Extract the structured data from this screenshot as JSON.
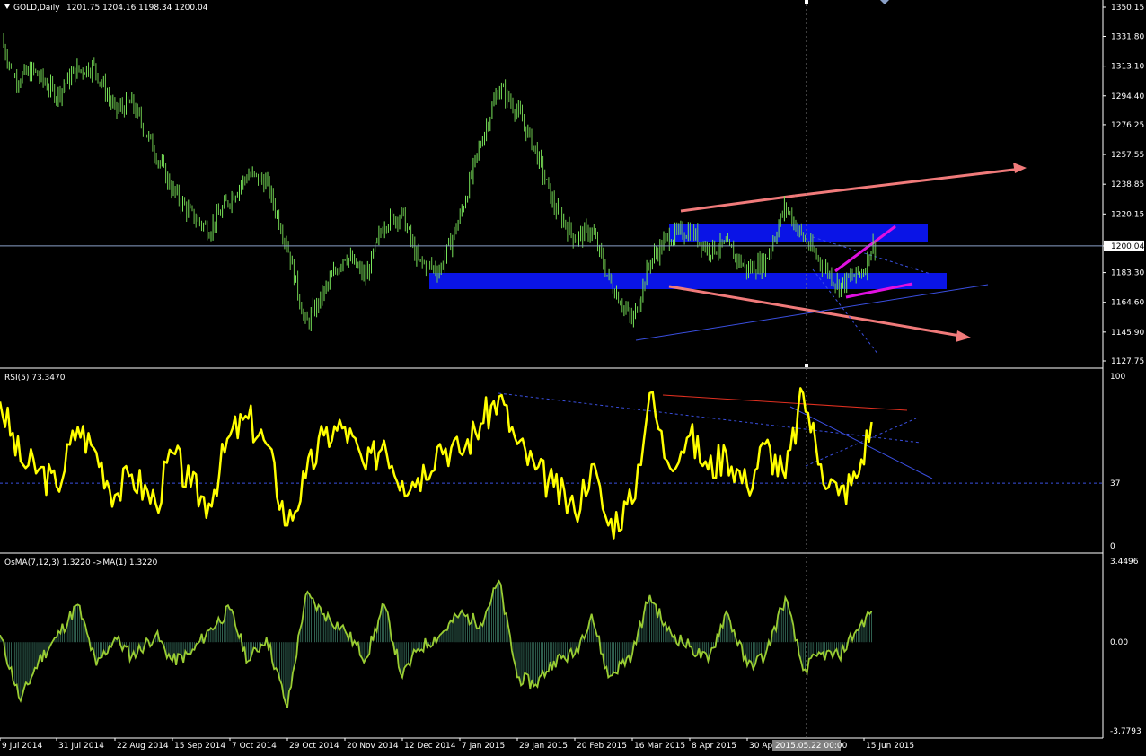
{
  "header": {
    "symbol": "GOLD,Daily",
    "ohlc": "1201.75 1204.16 1198.34 1200.04"
  },
  "colors": {
    "background": "#000000",
    "bull_candle": "#78e65a",
    "bear_candle": "#6ec84e",
    "rsi_line": "#ffff00",
    "osma_line": "#9acd32",
    "osma_hist": "#2f5f4f",
    "zone_fill": "#0a14e6",
    "trend_arrow": "#f07a7a",
    "magenta_line": "#e010e0",
    "trend_blue": "#3a4fe0",
    "grid_text": "#ffffff",
    "current_price_line": "#8aa0c8"
  },
  "chart_data": [
    {
      "type": "candlestick",
      "title": "GOLD,Daily",
      "ylim": [
        1127.75,
        1350.15
      ],
      "current_price": "1200.04",
      "y_tick_labels": [
        "1350.15",
        "1331.80",
        "1313.10",
        "1294.40",
        "1276.25",
        "1257.55",
        "1238.85",
        "1220.15",
        "1200.04",
        "1183.30",
        "1164.60",
        "1145.90",
        "1127.75"
      ],
      "x_tick_labels": [
        "9 Jul 2014",
        "31 Jul 2014",
        "22 Aug 2014",
        "15 Sep 2014",
        "7 Oct 2014",
        "29 Oct 2014",
        "20 Nov 2014",
        "12 Dec 2014",
        "7 Jan 2015",
        "29 Jan 2015",
        "20 Feb 2015",
        "16 Mar 2015",
        "8 Apr 2015",
        "30 Apr 2015",
        "15 Jun 2015"
      ],
      "crosshair_date_label": "2015.05.22 00:00",
      "close_path": [
        [
          "9 Jul 2014",
          1331
        ],
        [
          "15 Jul 2014",
          1305
        ],
        [
          "22 Jul 2014",
          1310
        ],
        [
          "31 Jul 2014",
          1295
        ],
        [
          "7 Aug 2014",
          1310
        ],
        [
          "14 Aug 2014",
          1313
        ],
        [
          "22 Aug 2014",
          1285
        ],
        [
          "29 Aug 2014",
          1290
        ],
        [
          "5 Sep 2014",
          1268
        ],
        [
          "15 Sep 2014",
          1235
        ],
        [
          "22 Sep 2014",
          1220
        ],
        [
          "29 Sep 2014",
          1210
        ],
        [
          "7 Oct 2014",
          1230
        ],
        [
          "14 Oct 2014",
          1245
        ],
        [
          "21 Oct 2014",
          1240
        ],
        [
          "29 Oct 2014",
          1200
        ],
        [
          "5 Nov 2014",
          1150
        ],
        [
          "10 Nov 2014",
          1165
        ],
        [
          "20 Nov 2014",
          1195
        ],
        [
          "28 Nov 2014",
          1180
        ],
        [
          "5 Dec 2014",
          1215
        ],
        [
          "12 Dec 2014",
          1220
        ],
        [
          "19 Dec 2014",
          1190
        ],
        [
          "29 Dec 2014",
          1185
        ],
        [
          "7 Jan 2015",
          1218
        ],
        [
          "15 Jan 2015",
          1265
        ],
        [
          "22 Jan 2015",
          1300
        ],
        [
          "29 Jan 2015",
          1285
        ],
        [
          "5 Feb 2015",
          1260
        ],
        [
          "12 Feb 2015",
          1225
        ],
        [
          "20 Feb 2015",
          1205
        ],
        [
          "27 Feb 2015",
          1210
        ],
        [
          "6 Mar 2015",
          1180
        ],
        [
          "16 Mar 2015",
          1152
        ],
        [
          "23 Mar 2015",
          1190
        ],
        [
          "30 Mar 2015",
          1205
        ],
        [
          "8 Apr 2015",
          1210
        ],
        [
          "15 Apr 2015",
          1198
        ],
        [
          "22 Apr 2015",
          1200
        ],
        [
          "30 Apr 2015",
          1185
        ],
        [
          "7 May 2015",
          1190
        ],
        [
          "15 May 2015",
          1225
        ],
        [
          "22 May 2015",
          1205
        ],
        [
          "29 May 2015",
          1190
        ],
        [
          "5 Jun 2015",
          1175
        ],
        [
          "15 Jun 2015",
          1185
        ],
        [
          "18 Jun 2015",
          1200
        ]
      ]
    },
    {
      "type": "line",
      "title": "RSI(5) 73.3470",
      "ylim": [
        0,
        100
      ],
      "y_tick_labels": [
        "100",
        "37",
        "0"
      ],
      "level": 37,
      "x": [
        "9 Jul 2014",
        "17 Jul 2014",
        "24 Jul 2014",
        "31 Jul 2014",
        "8 Aug 2014",
        "15 Aug 2014",
        "22 Aug 2014",
        "29 Aug 2014",
        "8 Sep 2014",
        "15 Sep 2014",
        "22 Sep 2014",
        "29 Sep 2014",
        "7 Oct 2014",
        "14 Oct 2014",
        "21 Oct 2014",
        "29 Oct 2014",
        "5 Nov 2014",
        "12 Nov 2014",
        "20 Nov 2014",
        "28 Nov 2014",
        "5 Dec 2014",
        "12 Dec 2014",
        "19 Dec 2014",
        "29 Dec 2014",
        "7 Jan 2015",
        "15 Jan 2015",
        "22 Jan 2015",
        "29 Jan 2015",
        "5 Feb 2015",
        "12 Feb 2015",
        "20 Feb 2015",
        "27 Feb 2015",
        "6 Mar 2015",
        "16 Mar 2015",
        "23 Mar 2015",
        "30 Mar 2015",
        "8 Apr 2015",
        "15 Apr 2015",
        "22 Apr 2015",
        "30 Apr 2015",
        "7 May 2015",
        "15 May 2015",
        "22 May 2015",
        "29 May 2015",
        "5 Jun 2015",
        "12 Jun 2015",
        "18 Jun 2015"
      ],
      "values": [
        85,
        50,
        45,
        35,
        70,
        55,
        30,
        42,
        25,
        55,
        35,
        25,
        65,
        75,
        60,
        12,
        40,
        65,
        70,
        45,
        62,
        38,
        40,
        60,
        55,
        72,
        88,
        60,
        45,
        35,
        20,
        48,
        12,
        25,
        90,
        50,
        65,
        45,
        55,
        35,
        60,
        40,
        90,
        48,
        30,
        40,
        73
      ]
    },
    {
      "type": "bar",
      "title": "OsMA(7,12,3) 1.3220  ->MA(1) 1.3220",
      "ylim": [
        -3.7793,
        3.4496
      ],
      "y_tick_labels": [
        "3.4496",
        "0.00",
        "-3.7793"
      ],
      "x": [
        "9 Jul 2014",
        "17 Jul 2014",
        "24 Jul 2014",
        "31 Jul 2014",
        "8 Aug 2014",
        "15 Aug 2014",
        "22 Aug 2014",
        "29 Aug 2014",
        "8 Sep 2014",
        "15 Sep 2014",
        "22 Sep 2014",
        "29 Sep 2014",
        "7 Oct 2014",
        "14 Oct 2014",
        "21 Oct 2014",
        "29 Oct 2014",
        "5 Nov 2014",
        "12 Nov 2014",
        "20 Nov 2014",
        "28 Nov 2014",
        "5 Dec 2014",
        "12 Dec 2014",
        "19 Dec 2014",
        "29 Dec 2014",
        "7 Jan 2015",
        "15 Jan 2015",
        "22 Jan 2015",
        "29 Jan 2015",
        "5 Feb 2015",
        "12 Feb 2015",
        "20 Feb 2015",
        "27 Feb 2015",
        "6 Mar 2015",
        "16 Mar 2015",
        "23 Mar 2015",
        "30 Mar 2015",
        "8 Apr 2015",
        "15 Apr 2015",
        "22 Apr 2015",
        "30 Apr 2015",
        "7 May 2015",
        "15 May 2015",
        "22 May 2015",
        "29 May 2015",
        "5 Jun 2015",
        "12 Jun 2015",
        "18 Jun 2015"
      ],
      "values": [
        0.3,
        -2.5,
        -0.8,
        0.2,
        1.6,
        -1.0,
        0.2,
        -0.6,
        0.3,
        -0.8,
        -0.5,
        0.5,
        1.4,
        -0.8,
        0.2,
        -2.8,
        2.0,
        1.2,
        0.5,
        -0.7,
        1.6,
        -1.5,
        -0.3,
        0.3,
        1.2,
        0.8,
        2.6,
        -1.5,
        -1.8,
        -0.8,
        -0.5,
        1.2,
        -1.5,
        -0.5,
        2.0,
        0.5,
        -0.2,
        -0.8,
        1.3,
        -1.0,
        -0.6,
        1.9,
        -1.2,
        -0.5,
        -0.6,
        0.5,
        1.32
      ]
    }
  ]
}
